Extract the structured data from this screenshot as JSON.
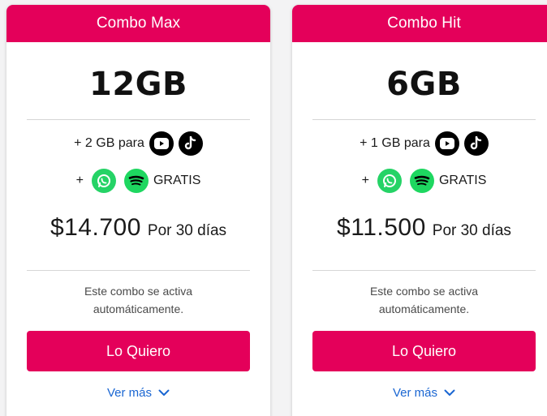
{
  "plans": [
    {
      "name": "Combo Max",
      "data": "12GB",
      "bonus_line": {
        "prefix": "+ 2 GB para",
        "icons": [
          "youtube-icon",
          "tiktok-icon"
        ]
      },
      "free_line": {
        "prefix": "+",
        "icons": [
          "whatsapp-icon",
          "spotify-icon"
        ],
        "label": "GRATIS"
      },
      "price": "$14.700",
      "period": "Por 30 días",
      "note_line1": "Este combo se activa",
      "note_line2": "automáticamente.",
      "cta": "Lo Quiero",
      "more": "Ver más"
    },
    {
      "name": "Combo Hit",
      "data": "6GB",
      "bonus_line": {
        "prefix": "+ 1 GB para",
        "icons": [
          "youtube-icon",
          "tiktok-icon"
        ]
      },
      "free_line": {
        "prefix": "+",
        "icons": [
          "whatsapp-icon",
          "spotify-icon"
        ],
        "label": "GRATIS"
      },
      "price": "$11.500",
      "period": "Por 30 días",
      "note_line1": "Este combo se activa",
      "note_line2": "automáticamente.",
      "cta": "Lo Quiero",
      "more": "Ver más"
    }
  ],
  "colors": {
    "brand": "#e4005a",
    "link": "#1a66d2",
    "whatsapp": "#25d366",
    "spotify": "#1ed760",
    "text": "#1a1a1a"
  }
}
